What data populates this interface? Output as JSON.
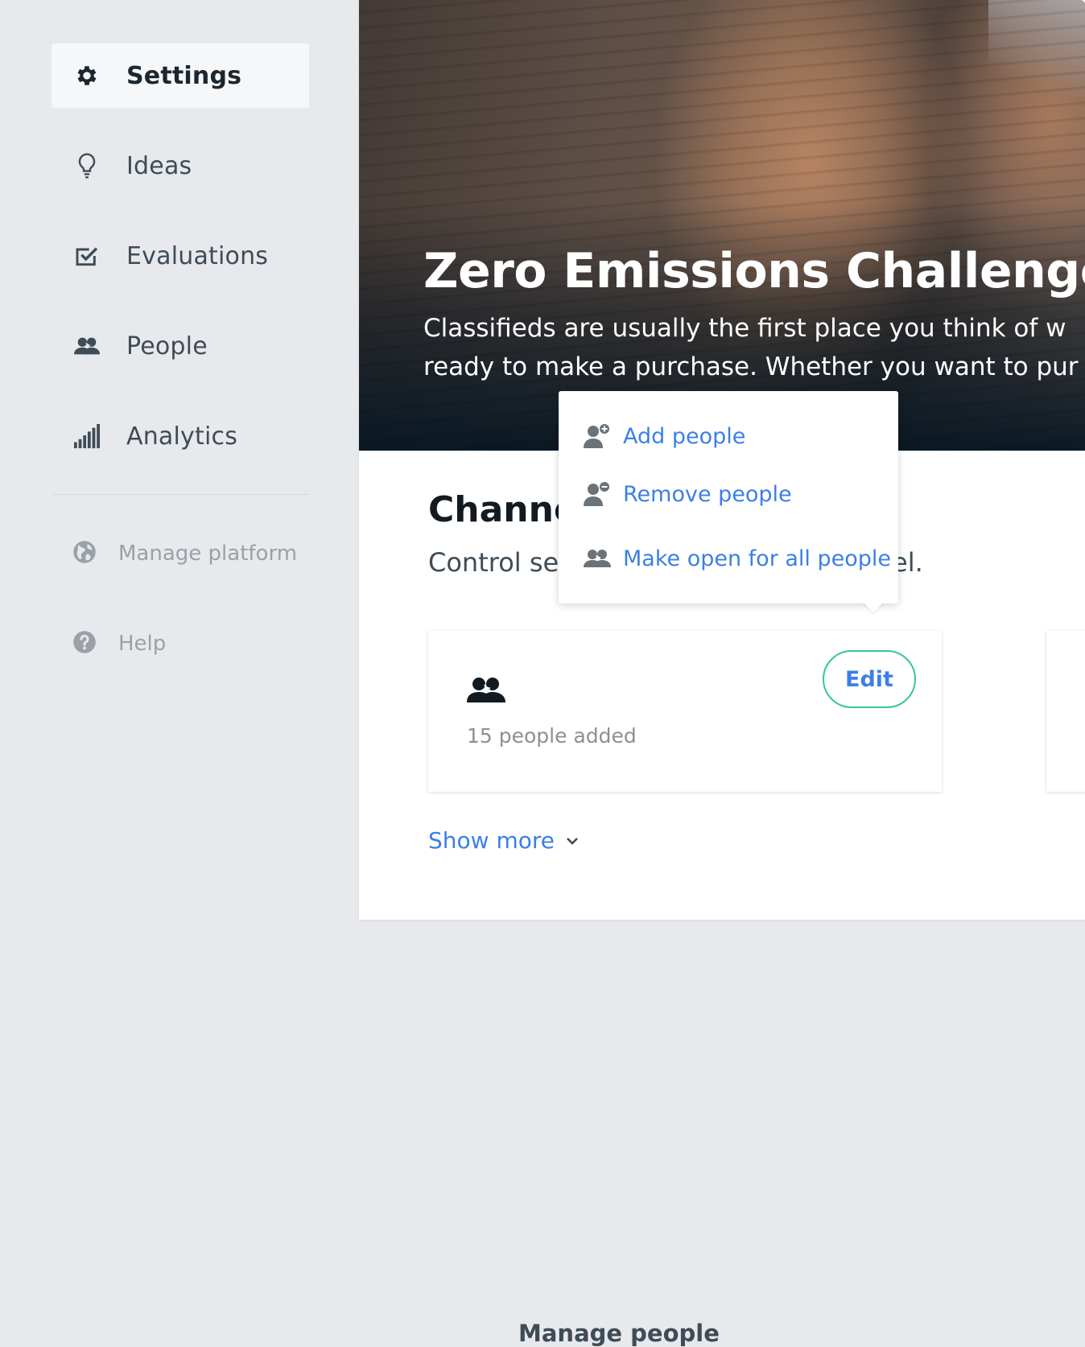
{
  "sidebar": {
    "items": [
      {
        "label": "Settings",
        "icon": "gear-icon",
        "active": true
      },
      {
        "label": "Ideas",
        "icon": "lightbulb-icon"
      },
      {
        "label": "Evaluations",
        "icon": "checkbox-icon"
      },
      {
        "label": "People",
        "icon": "people-icon"
      },
      {
        "label": "Analytics",
        "icon": "signal-bars-icon"
      }
    ],
    "secondary": [
      {
        "label": "Manage platform",
        "icon": "globe-icon"
      },
      {
        "label": "Help",
        "icon": "help-circle-icon"
      }
    ]
  },
  "hero": {
    "title": "Zero Emissions Challenge",
    "description_line1": "Classifieds are usually the first place you think of w",
    "description_line2": "ready to make a purchase. Whether you want to pur"
  },
  "channel": {
    "title": "Channe",
    "subtitle_visible": "Control se",
    "subtitle_tail": "el."
  },
  "card": {
    "title": "Manage people",
    "subtitle": "15 people added",
    "edit_label": "Edit"
  },
  "show_more": "Show more",
  "dropdown": {
    "items": [
      {
        "label": "Add people",
        "icon": "person-add-icon"
      },
      {
        "label": "Remove people",
        "icon": "person-remove-icon"
      },
      {
        "label": "Make open for all people",
        "icon": "people-icon"
      }
    ]
  },
  "colors": {
    "accent_blue": "#3c7fe6",
    "edit_border_green": "#36c59b",
    "sidebar_bg": "#e8e9ec",
    "active_bg": "#f6f7f9"
  }
}
